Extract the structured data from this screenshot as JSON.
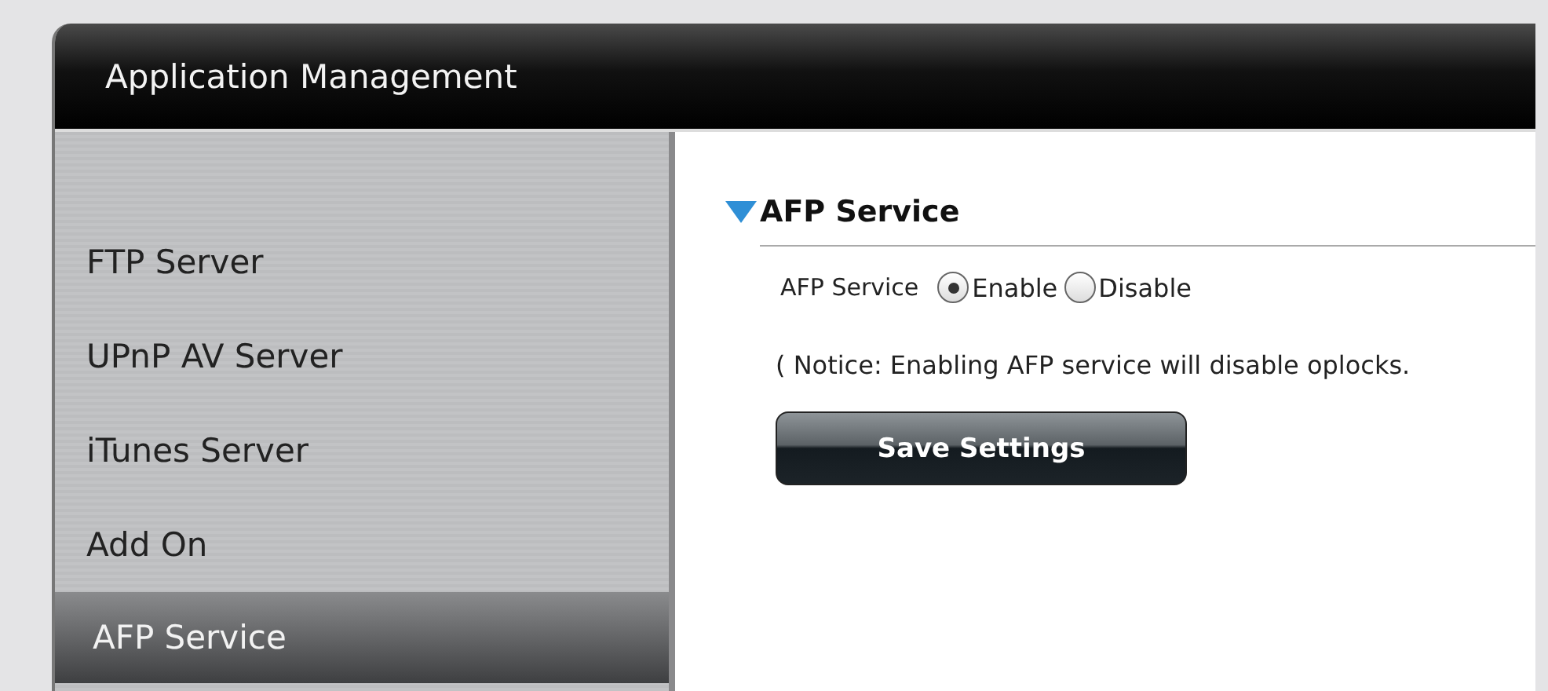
{
  "header": {
    "title": "Application Management"
  },
  "sidebar": {
    "items": [
      {
        "label": "FTP Server",
        "selected": false
      },
      {
        "label": "UPnP AV Server",
        "selected": false
      },
      {
        "label": "iTunes Server",
        "selected": false
      },
      {
        "label": "Add On",
        "selected": false
      },
      {
        "label": "AFP Service",
        "selected": true
      }
    ]
  },
  "section": {
    "title": "AFP Service",
    "field_label": "AFP Service",
    "options": [
      {
        "label": "Enable",
        "selected": true
      },
      {
        "label": "Disable",
        "selected": false
      }
    ],
    "notice": "( Notice: Enabling AFP service will disable oplocks.",
    "save_button": "Save Settings"
  }
}
